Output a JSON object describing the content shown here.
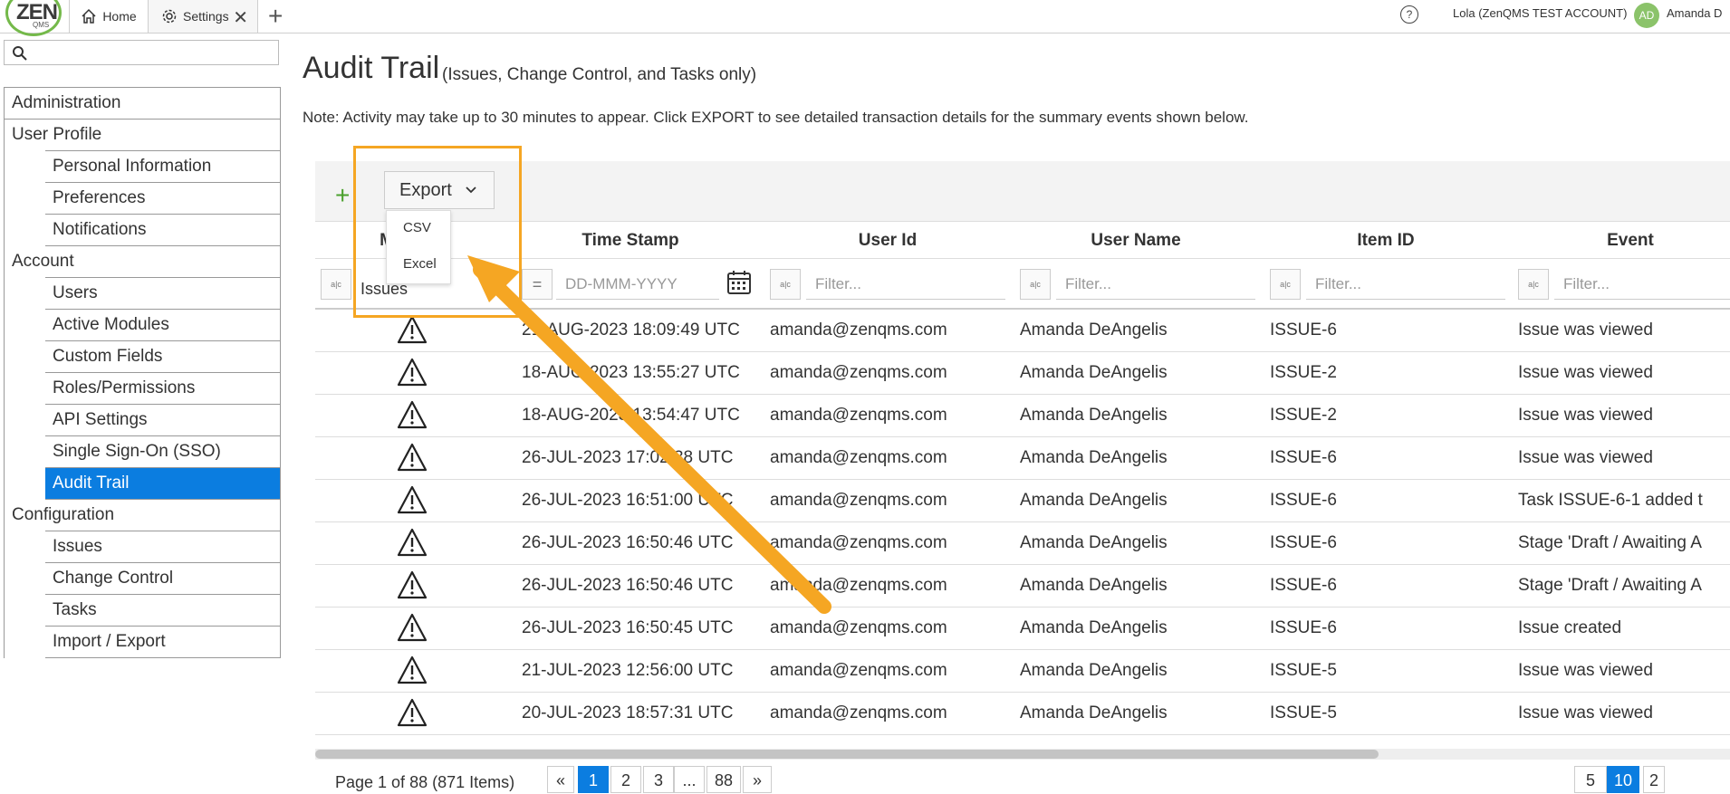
{
  "app": {
    "logo_text": "ZEN",
    "logo_sub": "QMS",
    "tabs": [
      {
        "label": "Home"
      },
      {
        "label": "Settings"
      }
    ],
    "account_label": "Lola (ZenQMS TEST ACCOUNT)",
    "avatar_initials": "AD",
    "user_name": "Amanda D"
  },
  "sidebar": {
    "search_placeholder": "",
    "items": [
      {
        "label": "Administration",
        "level": "section"
      },
      {
        "label": "User Profile",
        "level": "section"
      },
      {
        "label": "Personal Information",
        "level": "sub"
      },
      {
        "label": "Preferences",
        "level": "sub"
      },
      {
        "label": "Notifications",
        "level": "sub"
      },
      {
        "label": "Account",
        "level": "section"
      },
      {
        "label": "Users",
        "level": "sub"
      },
      {
        "label": "Active Modules",
        "level": "sub"
      },
      {
        "label": "Custom Fields",
        "level": "sub"
      },
      {
        "label": "Roles/Permissions",
        "level": "sub"
      },
      {
        "label": "API Settings",
        "level": "sub"
      },
      {
        "label": "Single Sign-On (SSO)",
        "level": "sub"
      },
      {
        "label": "Audit Trail",
        "level": "sub",
        "active": true
      },
      {
        "label": "Configuration",
        "level": "section"
      },
      {
        "label": "Issues",
        "level": "sub"
      },
      {
        "label": "Change Control",
        "level": "sub"
      },
      {
        "label": "Tasks",
        "level": "sub"
      },
      {
        "label": "Import / Export",
        "level": "sub"
      }
    ]
  },
  "main": {
    "title": "Audit Trail",
    "subtitle": "(Issues, Change Control, and Tasks only)",
    "note": "Note: Activity may take up to 30 minutes to appear. Click EXPORT to see detailed transaction details for the summary events shown below.",
    "export_label": "Export",
    "export_options": [
      "CSV",
      "Excel"
    ],
    "columns": [
      "M",
      "Time Stamp",
      "User Id",
      "User Name",
      "Item ID",
      "Event"
    ],
    "filters": {
      "module_value": "Issues",
      "date_placeholder": "DD-MMM-YYYY",
      "text_placeholder": "Filter..."
    },
    "rows": [
      {
        "time": "21-AUG-2023 18:09:49 UTC",
        "user_id": "amanda@zenqms.com",
        "user_name": "Amanda DeAngelis",
        "item": "ISSUE-6",
        "event": "Issue was viewed"
      },
      {
        "time": "18-AUG-2023 13:55:27 UTC",
        "user_id": "amanda@zenqms.com",
        "user_name": "Amanda DeAngelis",
        "item": "ISSUE-2",
        "event": "Issue was viewed"
      },
      {
        "time": "18-AUG-2023 13:54:47 UTC",
        "user_id": "amanda@zenqms.com",
        "user_name": "Amanda DeAngelis",
        "item": "ISSUE-2",
        "event": "Issue was viewed"
      },
      {
        "time": "26-JUL-2023 17:02:38 UTC",
        "user_id": "amanda@zenqms.com",
        "user_name": "Amanda DeAngelis",
        "item": "ISSUE-6",
        "event": "Issue was viewed"
      },
      {
        "time": "26-JUL-2023 16:51:00 UTC",
        "user_id": "amanda@zenqms.com",
        "user_name": "Amanda DeAngelis",
        "item": "ISSUE-6",
        "event": "Task ISSUE-6-1 added t"
      },
      {
        "time": "26-JUL-2023 16:50:46 UTC",
        "user_id": "amanda@zenqms.com",
        "user_name": "Amanda DeAngelis",
        "item": "ISSUE-6",
        "event": "Stage 'Draft / Awaiting A"
      },
      {
        "time": "26-JUL-2023 16:50:46 UTC",
        "user_id": "amanda@zenqms.com",
        "user_name": "Amanda DeAngelis",
        "item": "ISSUE-6",
        "event": "Stage 'Draft / Awaiting A"
      },
      {
        "time": "26-JUL-2023 16:50:45 UTC",
        "user_id": "amanda@zenqms.com",
        "user_name": "Amanda DeAngelis",
        "item": "ISSUE-6",
        "event": "Issue created"
      },
      {
        "time": "21-JUL-2023 12:56:00 UTC",
        "user_id": "amanda@zenqms.com",
        "user_name": "Amanda DeAngelis",
        "item": "ISSUE-5",
        "event": "Issue was viewed"
      },
      {
        "time": "20-JUL-2023 18:57:31 UTC",
        "user_id": "amanda@zenqms.com",
        "user_name": "Amanda DeAngelis",
        "item": "ISSUE-5",
        "event": "Issue was viewed"
      }
    ],
    "pager": {
      "info": "Page 1 of 88 (871 Items)",
      "pages": [
        "«",
        "1",
        "2",
        "3",
        "...",
        "88",
        "»"
      ],
      "active_page": "1",
      "page_sizes": [
        "5",
        "10",
        "2"
      ],
      "active_size": "10"
    }
  },
  "annotation": {
    "color": "#f5a623"
  },
  "icons": [
    "home-icon",
    "gear-icon",
    "close-icon",
    "plus-icon",
    "help-icon",
    "search-icon",
    "chevron-down-icon",
    "warning-icon",
    "calendar-icon",
    "equals-icon",
    "abc-filter-icon"
  ]
}
